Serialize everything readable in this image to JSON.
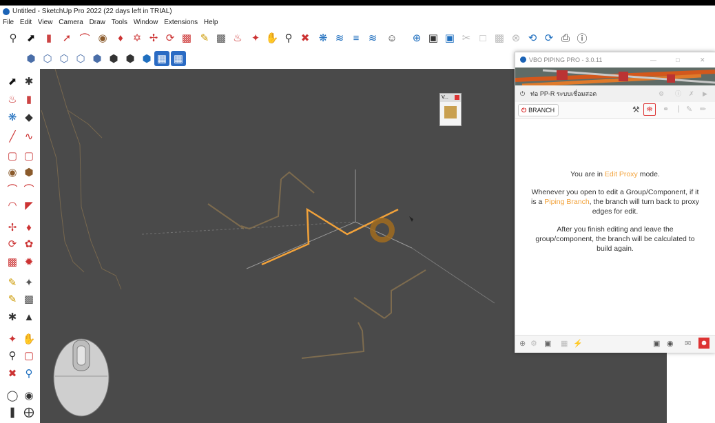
{
  "window": {
    "title": "Untitled - SketchUp Pro 2022 (22 days left in TRIAL)"
  },
  "menu": [
    "File",
    "Edit",
    "View",
    "Camera",
    "Draw",
    "Tools",
    "Window",
    "Extensions",
    "Help"
  ],
  "panel": {
    "title": "VBO PIPING PRO - 3.0.11",
    "pipe_label": "ท่อ PP-R ระบบเชื่อมสอด",
    "branch_label": "BRANCH",
    "msg1_pre": "You are in ",
    "msg1_hl": "Edit Proxy",
    "msg1_post": " mode.",
    "msg2_pre": "Whenever you open to edit a Group/Component, if it is a ",
    "msg2_hl": "Piping Branch",
    "msg2_post": ", the branch will turn back to proxy edges for edit.",
    "msg3": "After you finish editing and leave the group/component, the branch will be calculated to build again."
  },
  "viewport": {
    "tag_label": "V..."
  },
  "colors": {
    "viewport_bg": "#4a4a4a",
    "accent_orange": "#f2a23a",
    "power_red": "#d61c1c"
  }
}
